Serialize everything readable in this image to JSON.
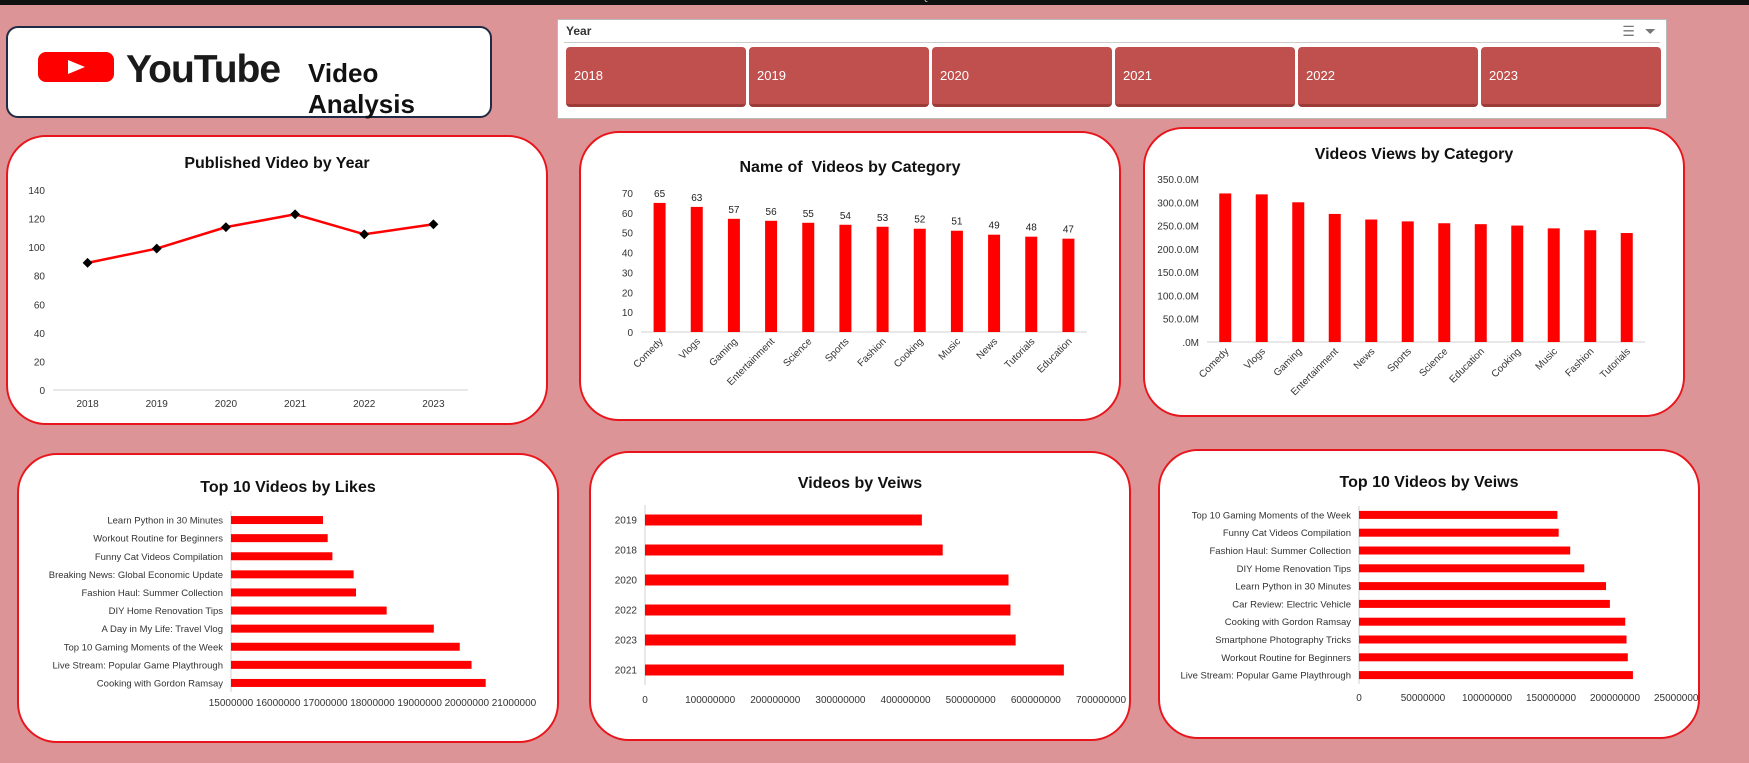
{
  "sheet": {
    "columns": [
      "A",
      "B",
      "C",
      "D",
      "E",
      "F",
      "G",
      "H",
      "I",
      "J",
      "K",
      "L",
      "M",
      "N",
      "O",
      "P",
      "Q",
      "R",
      "S",
      "T",
      "U",
      "V",
      "W",
      "X",
      "Y",
      "Z",
      "AA",
      "AB",
      "AC",
      "AD",
      "AE"
    ]
  },
  "header": {
    "logo_text": "YouTube",
    "subtitle": "Video Analysis"
  },
  "slicer": {
    "title": "Year",
    "items": [
      "2018",
      "2019",
      "2020",
      "2021",
      "2022",
      "2023"
    ],
    "icon_multiselect": "multi-select-icon",
    "icon_clear": "clear-filter-icon"
  },
  "colors": {
    "accent": "#ff0000",
    "slicer_button": "#c0504d",
    "background": "#dc9496",
    "card_border": "#e8161c"
  },
  "chart_data": [
    {
      "id": "pub_by_year",
      "type": "line",
      "title": "Published Video by Year",
      "x": [
        "2018",
        "2019",
        "2020",
        "2021",
        "2022",
        "2023"
      ],
      "values": [
        89,
        99,
        114,
        123,
        109,
        116
      ],
      "ylim": [
        0,
        140
      ],
      "yticks": [
        "0",
        "20",
        "40",
        "60",
        "80",
        "100",
        "120",
        "140"
      ],
      "grid": false,
      "legend": "none"
    },
    {
      "id": "count_by_category",
      "type": "bar",
      "title": "Name of  Videos by Category",
      "categories": [
        "Comedy",
        "Vlogs",
        "Gaming",
        "Entertainment",
        "Science",
        "Sports",
        "Fashion",
        "Cooking",
        "Music",
        "News",
        "Tutorials",
        "Education"
      ],
      "values": [
        65,
        63,
        57,
        56,
        55,
        54,
        53,
        52,
        51,
        49,
        48,
        47
      ],
      "ylim": [
        0,
        70
      ],
      "yticks": [
        "0",
        "10",
        "20",
        "30",
        "40",
        "50",
        "60",
        "70"
      ],
      "data_labels": [
        "65",
        "63",
        "57",
        "56",
        "55",
        "54",
        "53",
        "52",
        "51",
        "49",
        "48",
        "47"
      ]
    },
    {
      "id": "views_by_category",
      "type": "bar",
      "title": "Videos Views by Category",
      "categories": [
        "Comedy",
        "Vlogs",
        "Gaming",
        "Entertainment",
        "News",
        "Sports",
        "Science",
        "Education",
        "Cooking",
        "Music",
        "Fashion",
        "Tutorials"
      ],
      "values": [
        319,
        317,
        300,
        275,
        263,
        259,
        255,
        253,
        250,
        244,
        240,
        234
      ],
      "unit": "M",
      "ylim": [
        0,
        350
      ],
      "yticks": [
        ".0M",
        "50.0.0M",
        "100.0.0M",
        "150.0.0M",
        "200.0.0M",
        "250.0.0M",
        "300.0.0M",
        "350.0.0M"
      ]
    },
    {
      "id": "top10_likes",
      "type": "bar",
      "orientation": "horizontal",
      "title": "Top 10 Videos by Likes",
      "categories": [
        "Learn Python in 30 Minutes",
        "Workout Routine for Beginners",
        "Funny Cat Videos Compilation",
        "Breaking News: Global Economic Update",
        "Fashion Haul: Summer Collection",
        "DIY Home Renovation Tips",
        "A Day in My Life: Travel Vlog",
        "Top 10 Gaming Moments of the Week",
        "Live Stream: Popular Game Playthrough",
        "Cooking with Gordon Ramsay"
      ],
      "values": [
        16950000,
        17050000,
        17150000,
        17600000,
        17650000,
        18300000,
        19300000,
        19850000,
        20100000,
        20400000
      ],
      "xlim": [
        15000000,
        21000000
      ],
      "xticks": [
        "15000000",
        "16000000",
        "17000000",
        "18000000",
        "19000000",
        "20000000",
        "21000000"
      ]
    },
    {
      "id": "views_by_year",
      "type": "bar",
      "orientation": "horizontal",
      "title": "Videos by Veiws",
      "categories": [
        "2019",
        "2018",
        "2020",
        "2022",
        "2023",
        "2021"
      ],
      "values": [
        425000000,
        457000000,
        558000000,
        561000000,
        569000000,
        643000000
      ],
      "xlim": [
        0,
        700000000
      ],
      "xticks": [
        "0",
        "100000000",
        "200000000",
        "300000000",
        "400000000",
        "500000000",
        "600000000",
        "700000000"
      ]
    },
    {
      "id": "top10_views",
      "type": "bar",
      "orientation": "horizontal",
      "title": "Top 10 Videos by Veiws",
      "categories": [
        "Top 10 Gaming Moments of the Week",
        "Funny Cat Videos Compilation",
        "Fashion Haul: Summer Collection",
        "DIY Home Renovation Tips",
        "Learn Python in 30 Minutes",
        "Car Review: Electric Vehicle",
        "Cooking with Gordon Ramsay",
        "Smartphone Photography Tricks",
        "Workout Routine for Beginners",
        "Live Stream: Popular Game Playthrough"
      ],
      "values": [
        155000000,
        156000000,
        165000000,
        176000000,
        193000000,
        196000000,
        208000000,
        209000000,
        210000000,
        214000000
      ],
      "xlim": [
        0,
        250000000
      ],
      "xticks": [
        "0",
        "50000000",
        "100000000",
        "150000000",
        "200000000",
        "250000000"
      ]
    }
  ]
}
